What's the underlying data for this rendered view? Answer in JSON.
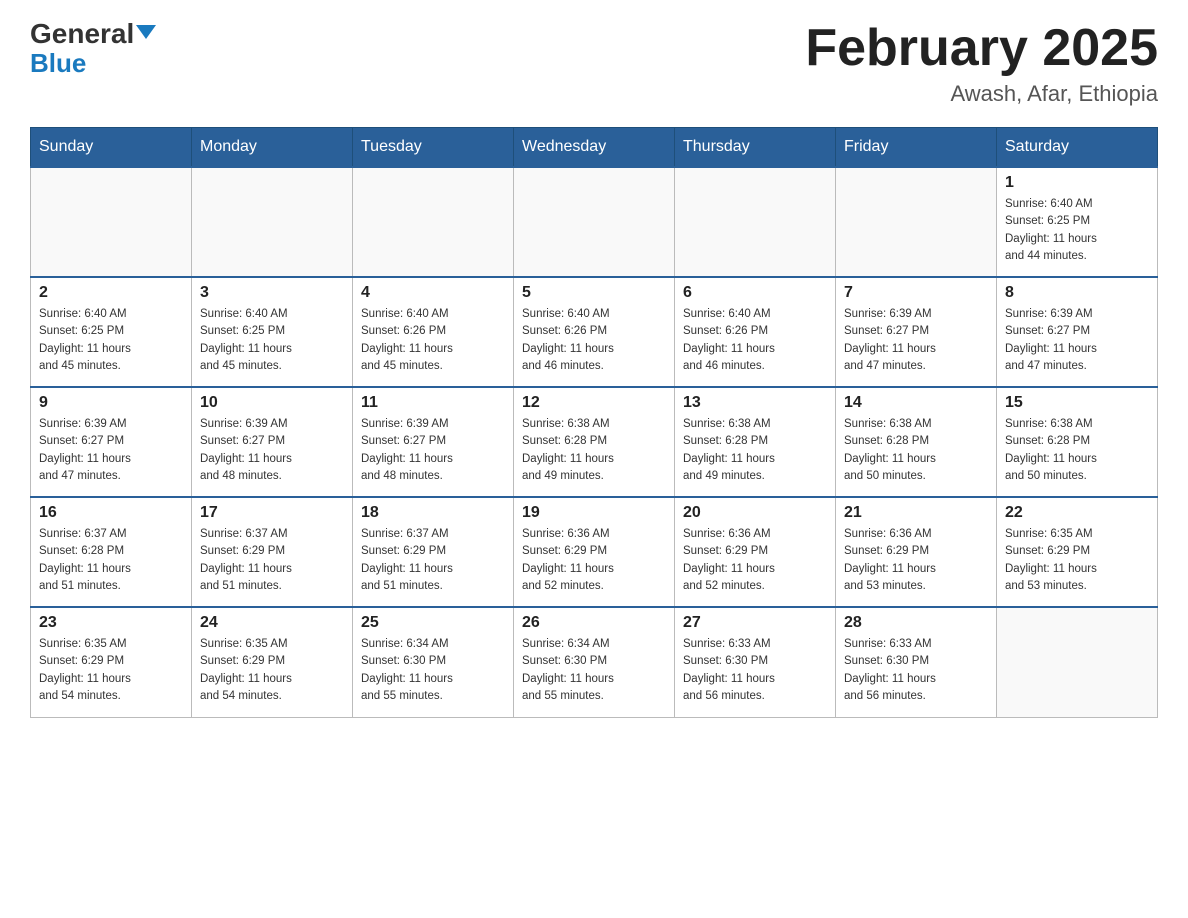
{
  "header": {
    "logo_general": "General",
    "logo_blue": "Blue",
    "month_title": "February 2025",
    "location": "Awash, Afar, Ethiopia"
  },
  "days_of_week": [
    "Sunday",
    "Monday",
    "Tuesday",
    "Wednesday",
    "Thursday",
    "Friday",
    "Saturday"
  ],
  "weeks": [
    [
      {
        "day": "",
        "info": ""
      },
      {
        "day": "",
        "info": ""
      },
      {
        "day": "",
        "info": ""
      },
      {
        "day": "",
        "info": ""
      },
      {
        "day": "",
        "info": ""
      },
      {
        "day": "",
        "info": ""
      },
      {
        "day": "1",
        "info": "Sunrise: 6:40 AM\nSunset: 6:25 PM\nDaylight: 11 hours\nand 44 minutes."
      }
    ],
    [
      {
        "day": "2",
        "info": "Sunrise: 6:40 AM\nSunset: 6:25 PM\nDaylight: 11 hours\nand 45 minutes."
      },
      {
        "day": "3",
        "info": "Sunrise: 6:40 AM\nSunset: 6:25 PM\nDaylight: 11 hours\nand 45 minutes."
      },
      {
        "day": "4",
        "info": "Sunrise: 6:40 AM\nSunset: 6:26 PM\nDaylight: 11 hours\nand 45 minutes."
      },
      {
        "day": "5",
        "info": "Sunrise: 6:40 AM\nSunset: 6:26 PM\nDaylight: 11 hours\nand 46 minutes."
      },
      {
        "day": "6",
        "info": "Sunrise: 6:40 AM\nSunset: 6:26 PM\nDaylight: 11 hours\nand 46 minutes."
      },
      {
        "day": "7",
        "info": "Sunrise: 6:39 AM\nSunset: 6:27 PM\nDaylight: 11 hours\nand 47 minutes."
      },
      {
        "day": "8",
        "info": "Sunrise: 6:39 AM\nSunset: 6:27 PM\nDaylight: 11 hours\nand 47 minutes."
      }
    ],
    [
      {
        "day": "9",
        "info": "Sunrise: 6:39 AM\nSunset: 6:27 PM\nDaylight: 11 hours\nand 47 minutes."
      },
      {
        "day": "10",
        "info": "Sunrise: 6:39 AM\nSunset: 6:27 PM\nDaylight: 11 hours\nand 48 minutes."
      },
      {
        "day": "11",
        "info": "Sunrise: 6:39 AM\nSunset: 6:27 PM\nDaylight: 11 hours\nand 48 minutes."
      },
      {
        "day": "12",
        "info": "Sunrise: 6:38 AM\nSunset: 6:28 PM\nDaylight: 11 hours\nand 49 minutes."
      },
      {
        "day": "13",
        "info": "Sunrise: 6:38 AM\nSunset: 6:28 PM\nDaylight: 11 hours\nand 49 minutes."
      },
      {
        "day": "14",
        "info": "Sunrise: 6:38 AM\nSunset: 6:28 PM\nDaylight: 11 hours\nand 50 minutes."
      },
      {
        "day": "15",
        "info": "Sunrise: 6:38 AM\nSunset: 6:28 PM\nDaylight: 11 hours\nand 50 minutes."
      }
    ],
    [
      {
        "day": "16",
        "info": "Sunrise: 6:37 AM\nSunset: 6:28 PM\nDaylight: 11 hours\nand 51 minutes."
      },
      {
        "day": "17",
        "info": "Sunrise: 6:37 AM\nSunset: 6:29 PM\nDaylight: 11 hours\nand 51 minutes."
      },
      {
        "day": "18",
        "info": "Sunrise: 6:37 AM\nSunset: 6:29 PM\nDaylight: 11 hours\nand 51 minutes."
      },
      {
        "day": "19",
        "info": "Sunrise: 6:36 AM\nSunset: 6:29 PM\nDaylight: 11 hours\nand 52 minutes."
      },
      {
        "day": "20",
        "info": "Sunrise: 6:36 AM\nSunset: 6:29 PM\nDaylight: 11 hours\nand 52 minutes."
      },
      {
        "day": "21",
        "info": "Sunrise: 6:36 AM\nSunset: 6:29 PM\nDaylight: 11 hours\nand 53 minutes."
      },
      {
        "day": "22",
        "info": "Sunrise: 6:35 AM\nSunset: 6:29 PM\nDaylight: 11 hours\nand 53 minutes."
      }
    ],
    [
      {
        "day": "23",
        "info": "Sunrise: 6:35 AM\nSunset: 6:29 PM\nDaylight: 11 hours\nand 54 minutes."
      },
      {
        "day": "24",
        "info": "Sunrise: 6:35 AM\nSunset: 6:29 PM\nDaylight: 11 hours\nand 54 minutes."
      },
      {
        "day": "25",
        "info": "Sunrise: 6:34 AM\nSunset: 6:30 PM\nDaylight: 11 hours\nand 55 minutes."
      },
      {
        "day": "26",
        "info": "Sunrise: 6:34 AM\nSunset: 6:30 PM\nDaylight: 11 hours\nand 55 minutes."
      },
      {
        "day": "27",
        "info": "Sunrise: 6:33 AM\nSunset: 6:30 PM\nDaylight: 11 hours\nand 56 minutes."
      },
      {
        "day": "28",
        "info": "Sunrise: 6:33 AM\nSunset: 6:30 PM\nDaylight: 11 hours\nand 56 minutes."
      },
      {
        "day": "",
        "info": ""
      }
    ]
  ]
}
